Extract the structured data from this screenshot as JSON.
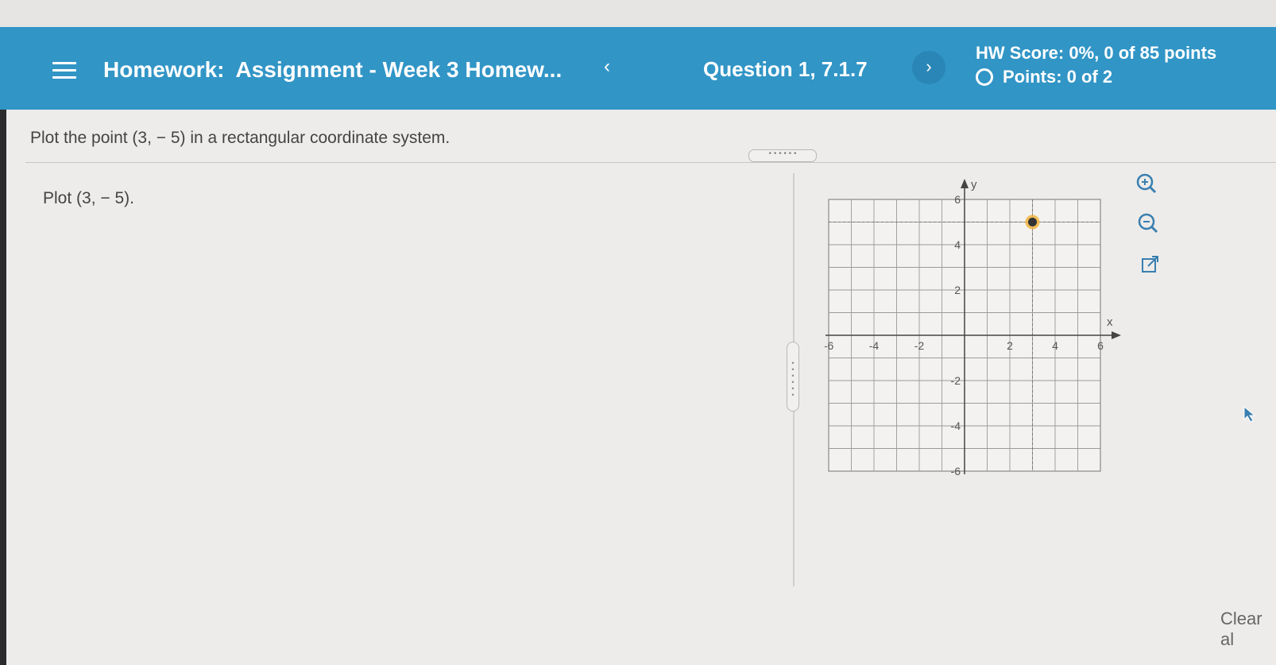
{
  "header": {
    "menu_icon": "hamburger-menu-icon",
    "homework_label": "Homework:",
    "assignment_title": "Assignment - Week 3 Homew...",
    "prev_label": "‹",
    "question_label": "Question 1, 7.1.7",
    "next_label": "›",
    "hw_score": "HW Score: 0%, 0 of 85 points",
    "points": "Points: 0 of 2",
    "accent_color": "#3195c6"
  },
  "main": {
    "instruction": "Plot the point (3, − 5) in a rectangular coordinate system.",
    "sub_prompt": "Plot (3, − 5).",
    "clear_all_label": "Clear al"
  },
  "graph": {
    "x_axis_label": "x",
    "y_axis_label": "y",
    "x_range": [
      -6,
      6
    ],
    "y_range": [
      -6,
      6
    ],
    "x_tick_labels": [
      "-6",
      "-4",
      "-2",
      "2",
      "4",
      "6"
    ],
    "y_tick_labels": [
      "6",
      "4",
      "2",
      "-2",
      "-4",
      "-6"
    ],
    "plotted_point": {
      "x": 3,
      "y": 5
    },
    "guide_lines": {
      "x": 3,
      "y": 5
    },
    "point_color": "#333333",
    "point_ring_color": "#f0b43c"
  },
  "tools": {
    "zoom_in": "zoom-in-icon",
    "zoom_out": "zoom-out-icon",
    "popout": "popout-icon"
  }
}
